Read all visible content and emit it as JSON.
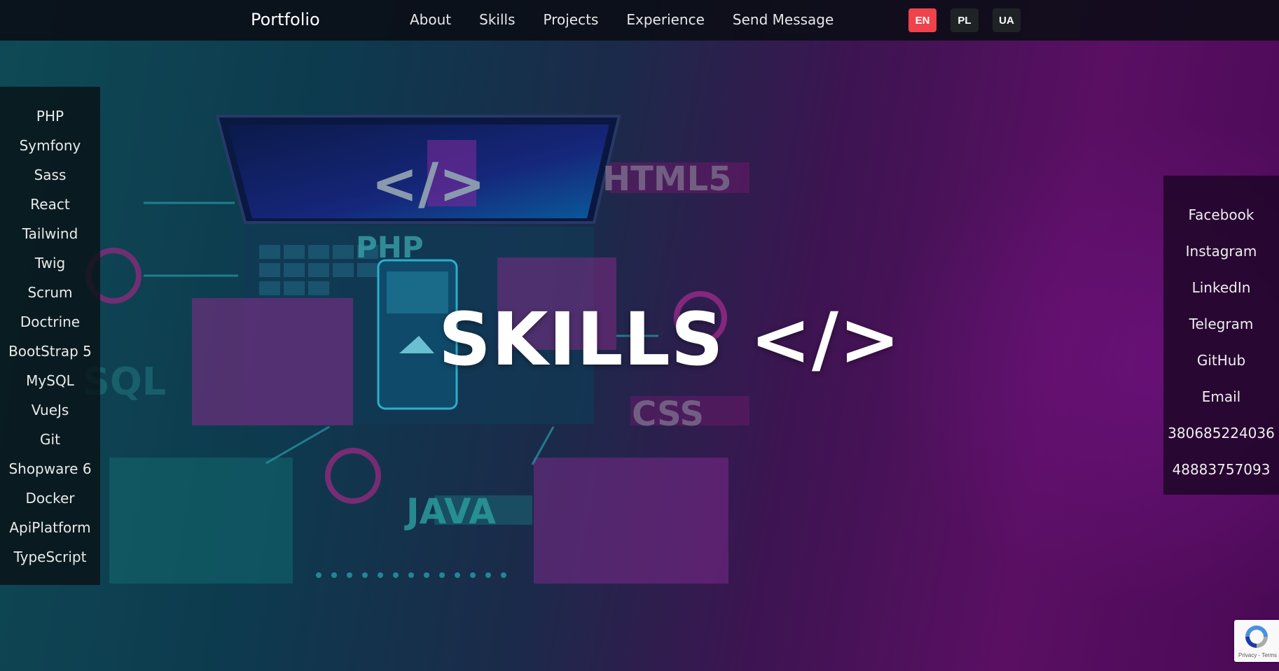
{
  "nav": {
    "brand": "Portfolio",
    "items": [
      "About",
      "Skills",
      "Projects",
      "Experience",
      "Send Message"
    ],
    "languages": [
      "EN",
      "PL",
      "UA"
    ],
    "active_language": "EN"
  },
  "skills": [
    "PHP",
    "Symfony",
    "Sass",
    "React",
    "Tailwind",
    "Twig",
    "Scrum",
    "Doctrine",
    "BootStrap 5",
    "MySQL",
    "VueJs",
    "Git",
    "Shopware 6",
    "Docker",
    "ApiPlatform",
    "TypeScript"
  ],
  "social": [
    "Facebook",
    "Instagram",
    "LinkedIn",
    "Telegram",
    "GitHub",
    "Email",
    "380685224036",
    "48883757093"
  ],
  "hero": {
    "title": "SKILLS </>",
    "artwork_labels": [
      "</>",
      "HTML5",
      "PHP",
      "SQL",
      "CSS",
      "JAVA"
    ]
  },
  "recaptcha": {
    "terms_text": "Privacy - Terms"
  },
  "colors": {
    "accent": "#f0424a",
    "lang_bg": "#1f2326"
  }
}
